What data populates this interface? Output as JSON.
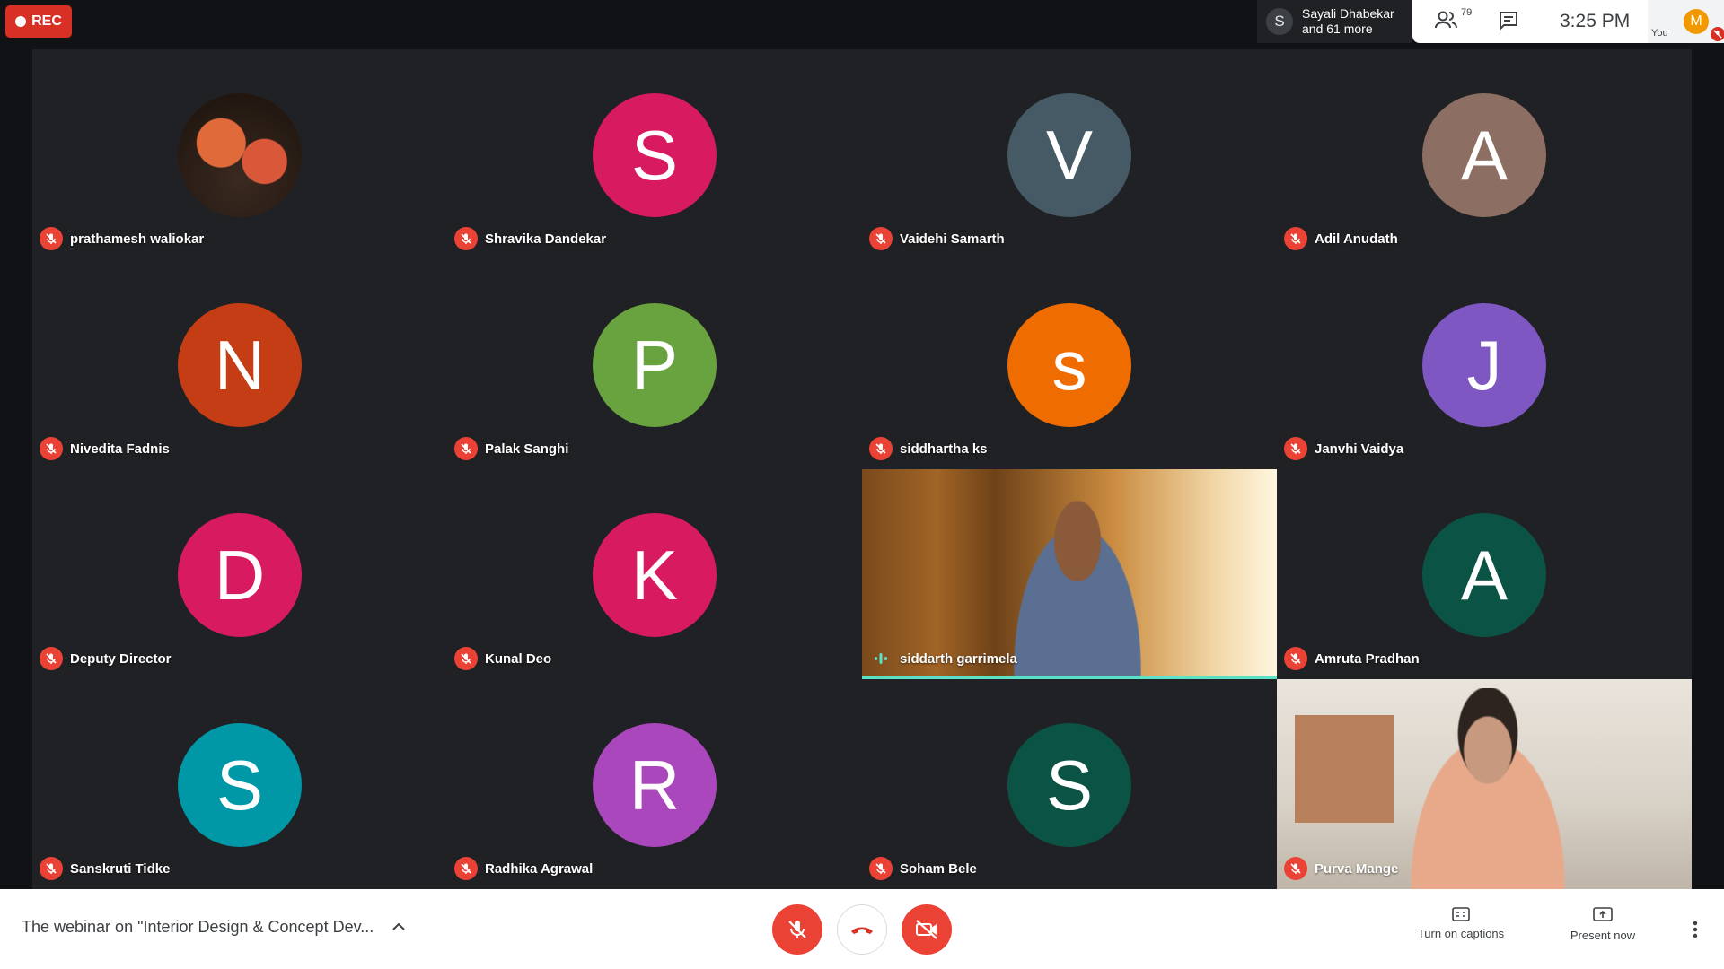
{
  "recording": {
    "label": "REC"
  },
  "presenter": {
    "initial": "S",
    "line1": "Sayali Dhabekar",
    "line2": "and 61 more"
  },
  "toolbar": {
    "participants_count": "79",
    "time": "3:25 PM",
    "self_initial": "M",
    "self_label": "You"
  },
  "participants": [
    {
      "name": "prathamesh waliokar",
      "type": "photo"
    },
    {
      "name": "Shravika Dandekar",
      "initial": "S",
      "color": "#d81b60"
    },
    {
      "name": "Vaidehi Samarth",
      "initial": "V",
      "color": "#455a64"
    },
    {
      "name": "Adil Anudath",
      "initial": "A",
      "color": "#8d6e63"
    },
    {
      "name": "Nivedita Fadnis",
      "initial": "N",
      "color": "#c53d14"
    },
    {
      "name": "Palak Sanghi",
      "initial": "P",
      "color": "#68a33f"
    },
    {
      "name": "siddhartha ks",
      "initial": "s",
      "color": "#ef6c00"
    },
    {
      "name": "Janvhi Vaidya",
      "initial": "J",
      "color": "#7e57c2"
    },
    {
      "name": "Deputy Director",
      "initial": "D",
      "color": "#d81b60"
    },
    {
      "name": "Kunal Deo",
      "initial": "K",
      "color": "#d81b60"
    },
    {
      "name": "siddarth garrimela",
      "type": "video"
    },
    {
      "name": "Amruta Pradhan",
      "initial": "A",
      "color": "#0b5345"
    },
    {
      "name": "Sanskruti Tidke",
      "initial": "S",
      "color": "#0097a7"
    },
    {
      "name": "Radhika Agrawal",
      "initial": "R",
      "color": "#ab47bc"
    },
    {
      "name": "Soham Bele",
      "initial": "S",
      "color": "#0b5345"
    },
    {
      "name": "Purva Mange",
      "type": "video"
    }
  ],
  "bottom": {
    "meeting_title": "The webinar on \"Interior Design & Concept Dev...",
    "captions_label": "Turn on captions",
    "present_label": "Present now"
  },
  "colors": {
    "accent_red": "#ea4335",
    "speaking": "#5de0c8"
  }
}
